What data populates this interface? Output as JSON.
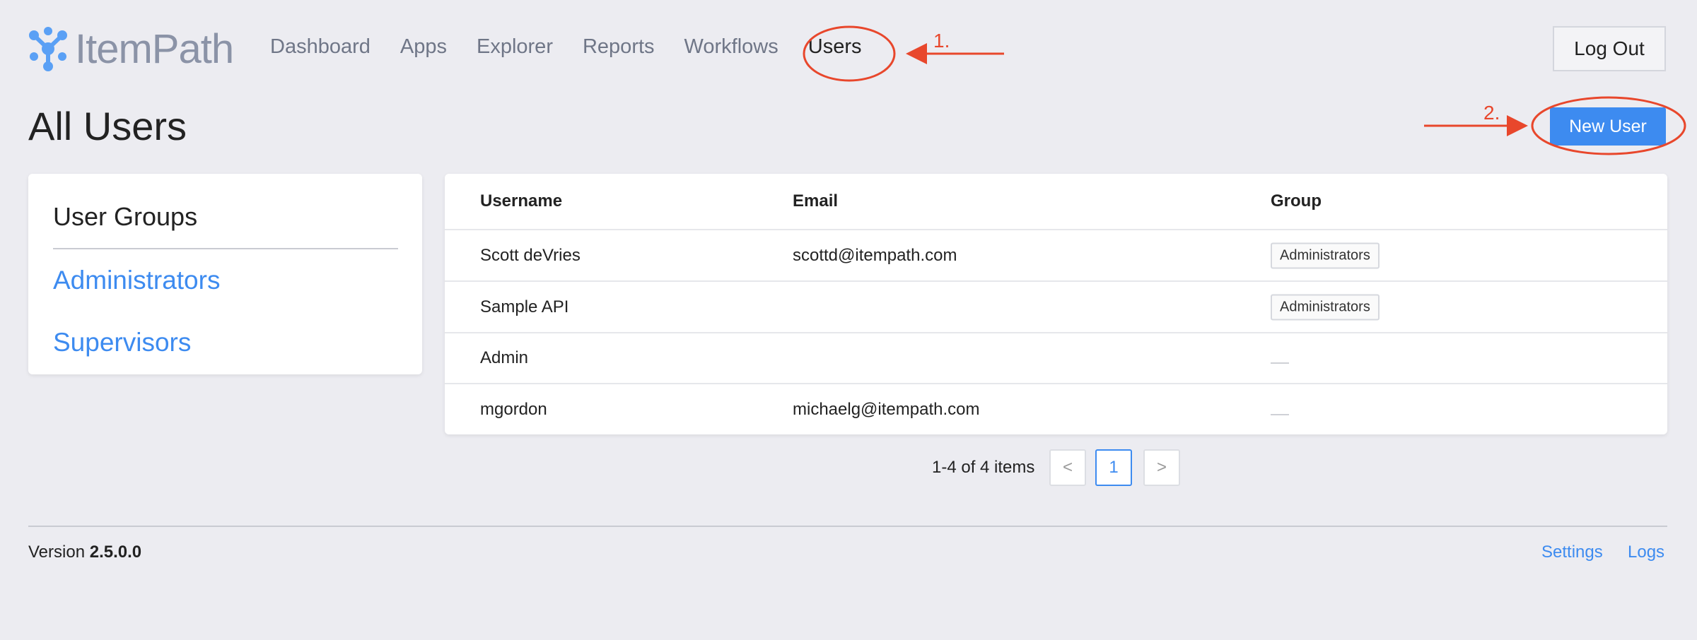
{
  "header": {
    "logo_text": "ItemPath",
    "nav": [
      "Dashboard",
      "Apps",
      "Explorer",
      "Reports",
      "Workflows",
      "Users"
    ],
    "active_nav": "Users",
    "logout_label": "Log Out"
  },
  "page": {
    "title": "All Users",
    "new_user_label": "New User"
  },
  "groups": {
    "title": "User Groups",
    "items": [
      "Administrators",
      "Supervisors"
    ]
  },
  "table": {
    "headers": [
      "Username",
      "Email",
      "Group"
    ],
    "rows": [
      {
        "username": "Scott deVries",
        "email": "scottd@itempath.com",
        "group": "Administrators"
      },
      {
        "username": "Sample API",
        "email": "",
        "group": "Administrators"
      },
      {
        "username": "Admin",
        "email": "",
        "group": ""
      },
      {
        "username": "mgordon",
        "email": "michaelg@itempath.com",
        "group": ""
      }
    ]
  },
  "pagination": {
    "summary": "1-4 of 4 items",
    "prev": "<",
    "current": "1",
    "next": ">"
  },
  "footer": {
    "version_label": "Version",
    "version_number": "2.5.0.0",
    "links": [
      "Settings",
      "Logs"
    ]
  },
  "annotations": {
    "step1": "1.",
    "step2": "2.",
    "color": "#e8472c"
  },
  "colors": {
    "accent": "#3d8bf0",
    "background": "#ececf1",
    "logo": "#8b93a7"
  }
}
